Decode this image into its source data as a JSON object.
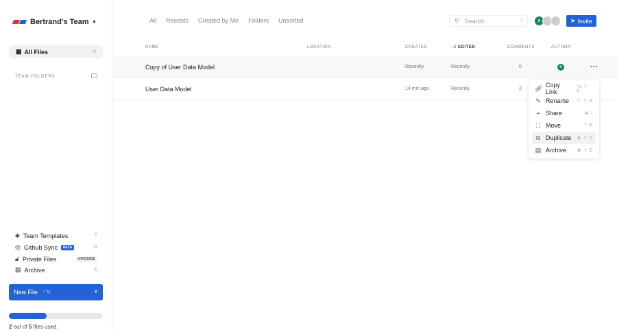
{
  "sidebar": {
    "team": "Bertrand's Team",
    "all_files": "All Files",
    "all_files_key": "A",
    "team_folders": "TEAM FOLDERS",
    "items": [
      {
        "label": "Team Templates",
        "key": "T"
      },
      {
        "label": "Github Sync",
        "badge": "BETA",
        "key": "G"
      },
      {
        "label": "Private Files",
        "badge": "UPGRADE"
      },
      {
        "label": "Archive",
        "key": "E"
      }
    ],
    "new_file": "New File",
    "new_file_key": "^ N",
    "usage": {
      "used": "2",
      "total": "5",
      "prefix": " out of ",
      "suffix": " files used.",
      "fraction": 0.4
    }
  },
  "tabs": [
    "All",
    "Recents",
    "Created by Me",
    "Folders",
    "Unsorted"
  ],
  "search": {
    "placeholder": "Search",
    "key": "/"
  },
  "avatars": [
    "B"
  ],
  "invite": "Invite",
  "columns": [
    "NAME",
    "LOCATION",
    "CREATED",
    "EDITED",
    "COMMENTS",
    "AUTHOR"
  ],
  "rows": [
    {
      "name": "Copy of User Data Model",
      "created": "Recently",
      "edited": "Recently",
      "comments": "0",
      "author": "B"
    },
    {
      "name": "User Data Model",
      "created": "14 min ago",
      "edited": "Recently",
      "comments": "2"
    }
  ],
  "menu": [
    {
      "label": "Copy Link",
      "key": "⌥ ⇧ C"
    },
    {
      "label": "Rename",
      "key": "⌥ ⇧ R"
    },
    {
      "label": "Share",
      "key": "⌘ I"
    },
    {
      "label": "Move",
      "key": "^ M"
    },
    {
      "label": "Duplicate",
      "key": "⌘ ⇧ D"
    },
    {
      "label": "Archive",
      "key": "⌘ ⇧ E"
    }
  ],
  "colors": {
    "accent": "#2463d6",
    "avatar": "#14875a"
  }
}
